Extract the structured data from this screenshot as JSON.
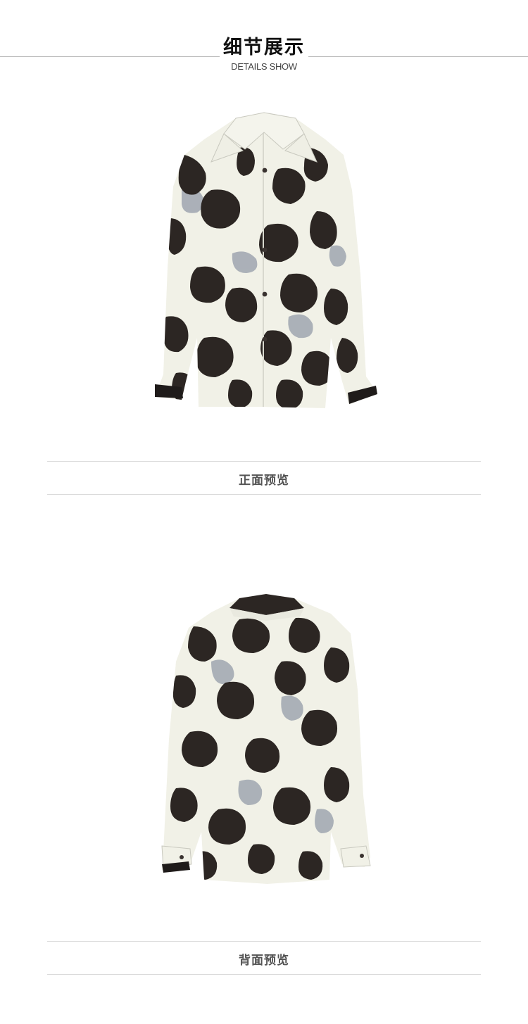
{
  "header": {
    "title_cn": "细节展示",
    "title_en": "DETAILS SHOW"
  },
  "views": {
    "front": {
      "caption": "正面预览"
    },
    "back": {
      "caption": "背面预览"
    }
  },
  "colors": {
    "fabric": "#f1f1e7",
    "print_dark": "#2c2623",
    "print_shadow": "#9aa1ad",
    "rule": "#d9d9d9",
    "caption_text": "#555555"
  }
}
